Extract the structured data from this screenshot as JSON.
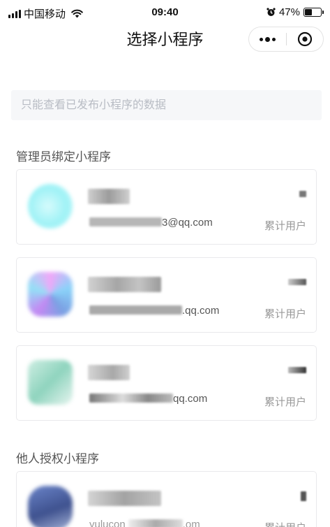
{
  "status_bar": {
    "carrier": "中国移动",
    "time": "09:40",
    "battery": "47%",
    "battery_level": 0.47
  },
  "nav": {
    "title": "选择小程序"
  },
  "notice": "只能查看已发布小程序的数据",
  "sections": {
    "admin": "管理员绑定小程序",
    "authorized": "他人授权小程序"
  },
  "cards": [
    {
      "email_visible": "3@qq.com",
      "stat_label": "累计用户"
    },
    {
      "email_visible": ".qq.com",
      "stat_label": "累计用户"
    },
    {
      "email_visible": "qq.com",
      "stat_label": "累计用户"
    },
    {
      "email_visible": "yulucon",
      "email_tail": ".om",
      "stat_label": "累计用户"
    }
  ]
}
